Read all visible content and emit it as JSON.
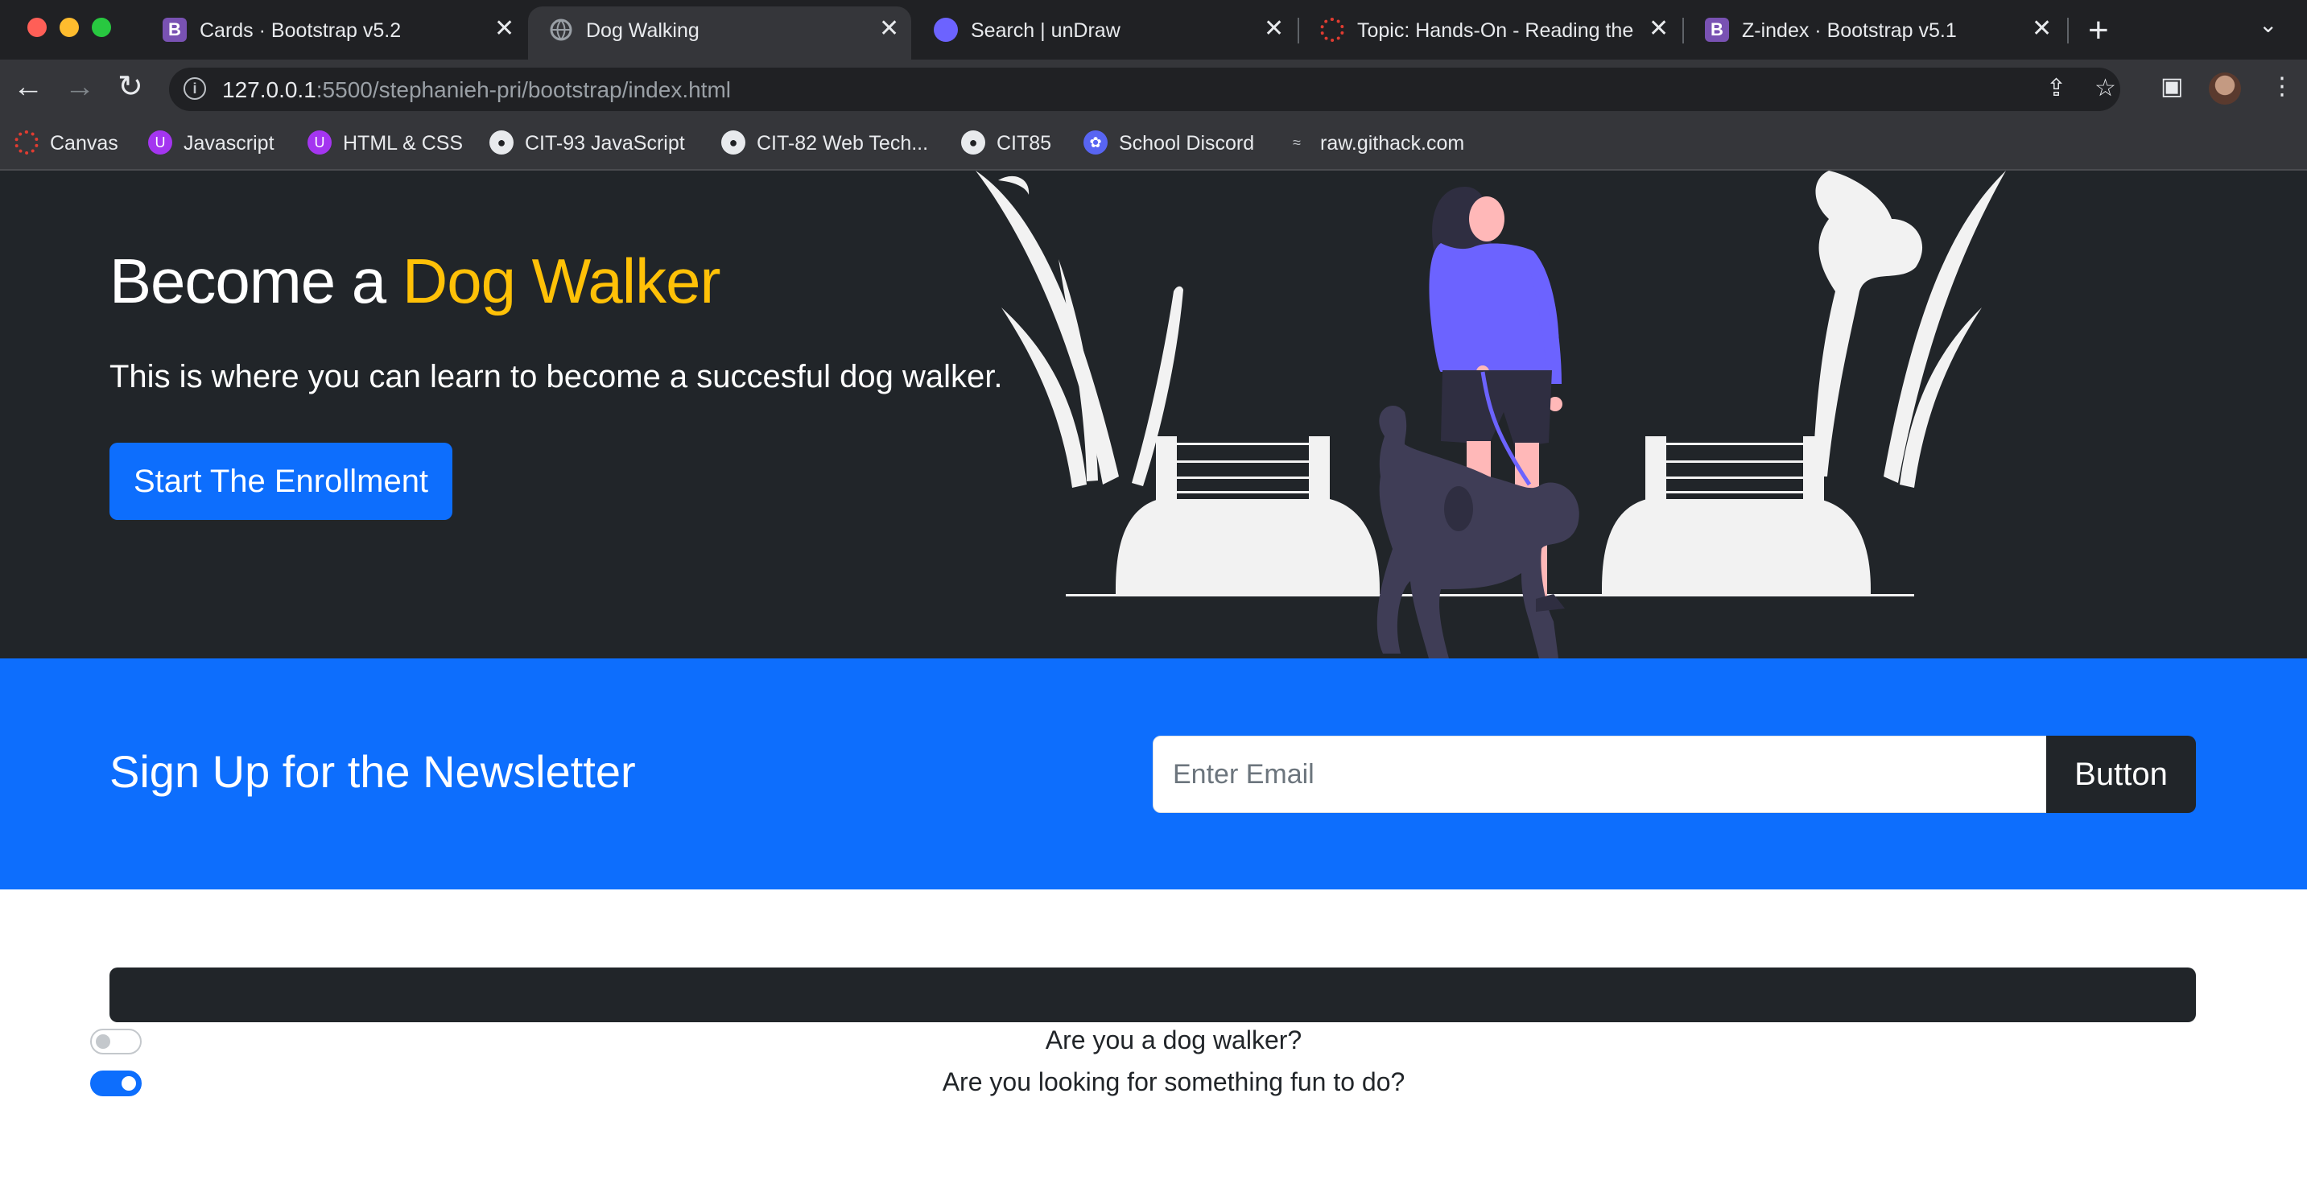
{
  "browser": {
    "tabs": [
      {
        "title": "Cards · Bootstrap v5.2",
        "icon": "bootstrap-icon"
      },
      {
        "title": "Dog Walking",
        "icon": "globe-icon"
      },
      {
        "title": "Search | unDraw",
        "icon": "undraw-icon"
      },
      {
        "title": "Topic: Hands-On - Reading the",
        "icon": "canvas-icon"
      },
      {
        "title": "Z-index · Bootstrap v5.1",
        "icon": "bootstrap-icon"
      }
    ],
    "url_host": "127.0.0.1",
    "url_rest": ":5500/stephanieh-pri/bootstrap/index.html",
    "bookmarks": [
      {
        "label": "Canvas",
        "icon": "canvas-icon"
      },
      {
        "label": "Javascript",
        "icon": "udemy-icon"
      },
      {
        "label": "HTML & CSS",
        "icon": "udemy-icon"
      },
      {
        "label": "CIT-93 JavaScript",
        "icon": "github-icon"
      },
      {
        "label": "CIT-82 Web Tech...",
        "icon": "github-icon"
      },
      {
        "label": "CIT85",
        "icon": "github-icon"
      },
      {
        "label": "School Discord",
        "icon": "discord-icon"
      },
      {
        "label": "raw.githack.com",
        "icon": "githack-icon"
      }
    ]
  },
  "hero": {
    "title_prefix": "Become a ",
    "title_accent": "Dog Walker",
    "subtitle": "This is where you can learn to become a succesful dog walker.",
    "cta_label": "Start The Enrollment"
  },
  "newsletter": {
    "title": "Sign Up for the Newsletter",
    "email_placeholder": "Enter Email",
    "email_value": "",
    "button_label": "Button"
  },
  "questions": [
    {
      "label": "Are you a dog walker?",
      "checked": false
    },
    {
      "label": "Are you looking for something fun to do?",
      "checked": true
    }
  ],
  "colors": {
    "primary": "#0d6efd",
    "dark": "#212529",
    "accent": "#ffc107",
    "illustration_accent": "#6c63ff"
  }
}
